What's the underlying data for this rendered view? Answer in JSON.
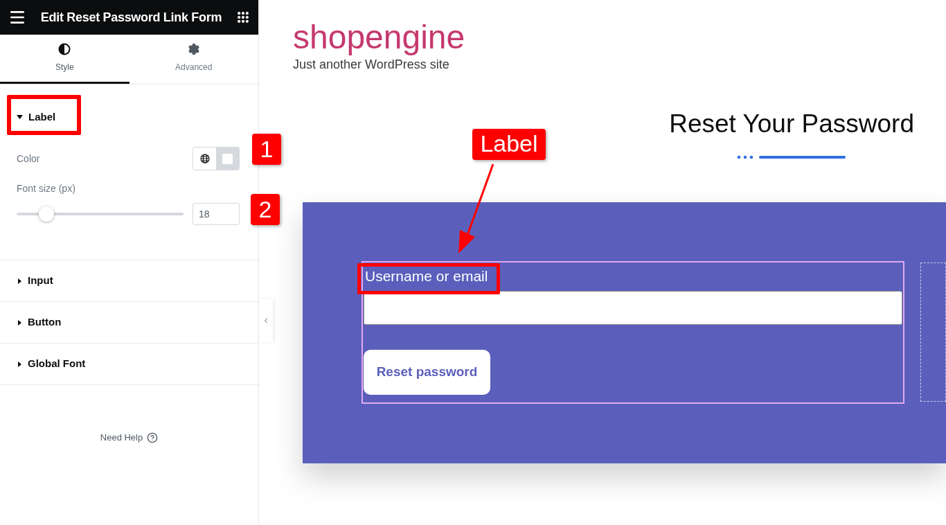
{
  "panel": {
    "title": "Edit Reset Password Link Form",
    "tabs": [
      {
        "label": "Style",
        "kind": "style",
        "selected": true
      },
      {
        "label": "Advanced",
        "kind": "advanced",
        "selected": false
      }
    ],
    "sections": [
      {
        "title": "Label",
        "expanded": true,
        "controls": [
          {
            "kind": "color",
            "label": "Color"
          },
          {
            "kind": "slider",
            "label": "Font size (px)",
            "level": 0.18,
            "value": "18"
          }
        ]
      },
      {
        "title": "Input",
        "expanded": false
      },
      {
        "title": "Button",
        "expanded": false
      },
      {
        "title": "Global Font",
        "expanded": false
      }
    ],
    "help": "Need Help"
  },
  "site": {
    "name": "shopengine",
    "tagline": "Just another WordPress site"
  },
  "page": {
    "heading": "Reset Your Password",
    "form": {
      "label": "Username or email",
      "button": "Reset password"
    }
  },
  "annotations": {
    "callouts": [
      "1",
      "2"
    ],
    "label_callout": "Label"
  }
}
